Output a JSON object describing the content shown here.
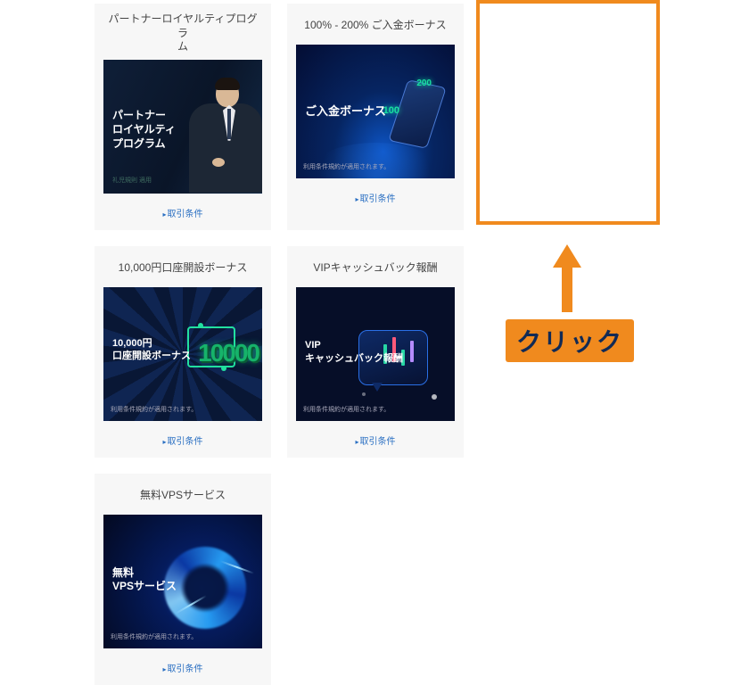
{
  "cards": [
    {
      "title": "パートナーロイヤルティプログラ\nム",
      "image_heading": "パートナー\nロイヤルティ\nプログラム",
      "image_sub": "礼児規則 適用",
      "terms": "取引条件"
    },
    {
      "title": "100% - 200% ご入金ボーナス",
      "image_heading": "ご入金ボーナス",
      "num_a": "200",
      "num_b": "100",
      "footnote": "利用条件規約が適用されます。",
      "terms": "取引条件"
    },
    {
      "title": "10,000円口座開設ボーナス",
      "image_heading": "10,000円\n口座開設ボーナス",
      "big_number": "10000",
      "footnote": "利用条件規約が適用されます。",
      "terms": "取引条件"
    },
    {
      "title": "VIPキャッシュバック報酬",
      "image_heading": "VIP\nキャッシュバック報酬",
      "footnote": "利用条件規約が適用されます。",
      "terms": "取引条件"
    },
    {
      "title": "無料VPSサービス",
      "image_heading": "無料\nVPSサービス",
      "footnote": "利用条件規約が適用されます。",
      "terms": "取引条件"
    }
  ],
  "annotation": {
    "click_label": "クリック",
    "highlight_card_index": 2
  },
  "colors": {
    "highlight": "#f08a1e",
    "link": "#2a6fc2",
    "card_bg": "#f7f7f7"
  }
}
